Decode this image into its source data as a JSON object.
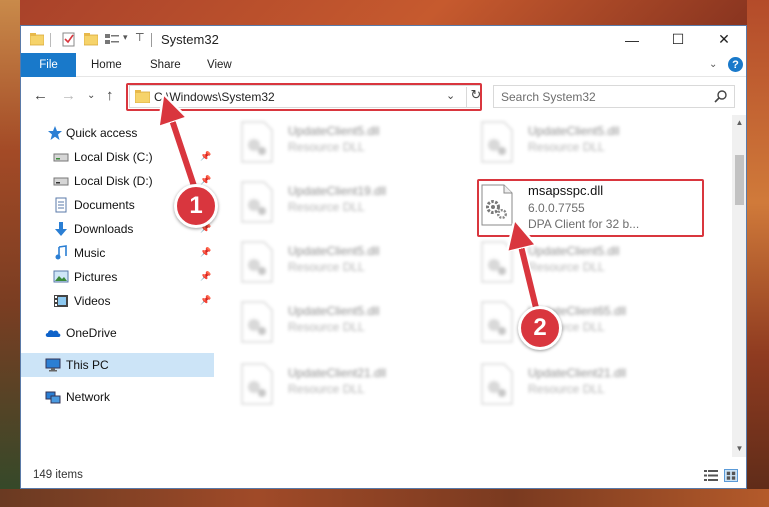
{
  "window": {
    "title": "System32",
    "controls": {
      "minimize": "—",
      "maximize": "☐",
      "close": "✕"
    }
  },
  "ribbon": {
    "file": "File",
    "tabs": [
      "Home",
      "Share",
      "View"
    ],
    "expand": "⌄",
    "help": "?"
  },
  "address": {
    "path": "C:\\Windows\\System32",
    "dropdown": "⌄",
    "refresh": "↻"
  },
  "search": {
    "placeholder": "Search System32"
  },
  "nav": {
    "back": "←",
    "forward": "→",
    "recent": "⌄",
    "up": "↑",
    "items": [
      {
        "label": "Quick access",
        "icon": "star-icon",
        "pinned": false
      },
      {
        "label": "Local Disk (C:)",
        "icon": "drive-icon",
        "pinned": true
      },
      {
        "label": "Local Disk (D:)",
        "icon": "drive-icon",
        "pinned": true
      },
      {
        "label": "Documents",
        "icon": "documents-icon",
        "pinned": true
      },
      {
        "label": "Downloads",
        "icon": "download-icon",
        "pinned": true
      },
      {
        "label": "Music",
        "icon": "music-icon",
        "pinned": true
      },
      {
        "label": "Pictures",
        "icon": "pictures-icon",
        "pinned": true
      },
      {
        "label": "Videos",
        "icon": "videos-icon",
        "pinned": true
      },
      {
        "label": "OneDrive",
        "icon": "cloud-icon",
        "pinned": false
      },
      {
        "label": "This PC",
        "icon": "computer-icon",
        "pinned": false
      },
      {
        "label": "Network",
        "icon": "network-icon",
        "pinned": false
      }
    ],
    "pin_glyph": "📌"
  },
  "files": [
    {
      "name": "UpdateClient5.dll",
      "type": "Resource DLL"
    },
    {
      "name": "UpdateClient5.dll",
      "type": "Resource DLL"
    },
    {
      "name": "UpdateClient19.dll",
      "type": "Resource DLL"
    },
    {
      "name": "msapsspc.dll",
      "version": "6.0.0.7755",
      "desc": "DPA Client for 32 b..."
    },
    {
      "name": "UpdateClient5.dll",
      "type": "Resource DLL"
    },
    {
      "name": "UpdateClient5.dll",
      "type": "Resource DLL"
    },
    {
      "name": "UpdateClient5.dll",
      "type": "Resource DLL"
    },
    {
      "name": "UpdateClient65.dll",
      "type": "Resource DLL"
    },
    {
      "name": "UpdateClient21.dll",
      "type": "Resource DLL"
    },
    {
      "name": "UpdateClient21.dll",
      "type": "Resource DLL"
    }
  ],
  "status": {
    "items": "149 items"
  },
  "annotations": {
    "step1": "1",
    "step2": "2"
  },
  "colors": {
    "accent": "#1979ca",
    "highlight": "#d9363e",
    "selected": "#cce4f7"
  }
}
